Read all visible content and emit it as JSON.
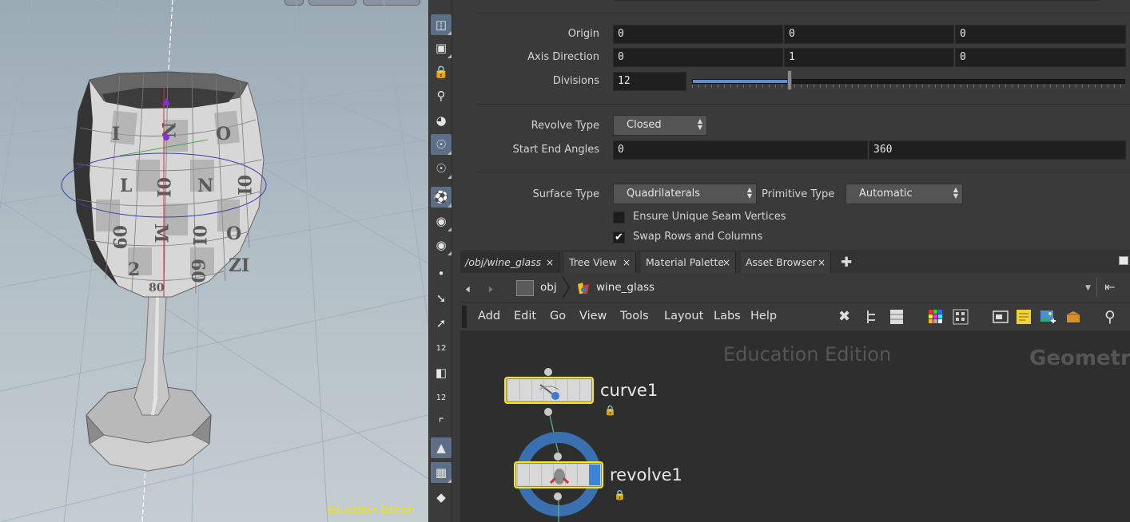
{
  "viewport": {
    "watermark": "Education Edition",
    "uv_labels": [
      "N",
      "O",
      "I",
      "L",
      "0I",
      "N",
      "0I",
      "M",
      "O",
      "0I",
      "09",
      "60",
      "2",
      "ZI",
      "80"
    ]
  },
  "shelf": {
    "tools": [
      {
        "icon": "view-layers-icon",
        "active": true
      },
      {
        "icon": "display-options-icon",
        "active": false
      },
      {
        "icon": "lock-camera-icon",
        "active": false
      },
      {
        "icon": "ghost-icon",
        "active": false
      },
      {
        "icon": "snapshot-icon",
        "active": false
      },
      {
        "icon": "light-bulb-icon",
        "active": true
      },
      {
        "icon": "light-link-icon",
        "active": false
      },
      {
        "icon": "shading-icon",
        "active": true
      },
      {
        "icon": "eye-visibility-icon",
        "active": false
      },
      {
        "icon": "template-icon",
        "active": false
      },
      {
        "icon": "point-display-icon",
        "active": false
      },
      {
        "icon": "normal-display-icon",
        "active": false
      },
      {
        "icon": "vector-display-icon",
        "active": false
      },
      {
        "icon": "point-number-icon",
        "text": "12",
        "active": false
      },
      {
        "icon": "primitive-normal-icon",
        "active": false
      },
      {
        "icon": "primitive-number-icon",
        "text": "12",
        "active": false
      },
      {
        "icon": "vertex-icon",
        "active": false
      },
      {
        "icon": "shaded-surface-icon",
        "active": true
      },
      {
        "icon": "texture-checker-icon",
        "active": true
      },
      {
        "icon": "uv-icon",
        "active": false
      }
    ]
  },
  "params": {
    "origin": {
      "label": "Origin",
      "x": "0",
      "y": "0",
      "z": "0"
    },
    "axis_direction": {
      "label": "Axis Direction",
      "x": "0",
      "y": "1",
      "z": "0"
    },
    "divisions": {
      "label": "Divisions",
      "value": "12",
      "slider_fraction": 0.225
    },
    "revolve_type": {
      "label": "Revolve Type",
      "value": "Closed"
    },
    "start_end_angles": {
      "label": "Start End Angles",
      "start": "0",
      "end": "360"
    },
    "surface_type": {
      "label": "Surface Type",
      "value": "Quadrilaterals"
    },
    "primitive_type": {
      "label": "Primitive Type",
      "value": "Automatic"
    },
    "ensure_unique": {
      "label": "Ensure Unique Seam Vertices",
      "checked": false
    },
    "swap_rows": {
      "label": "Swap Rows and Columns",
      "checked": true
    }
  },
  "network": {
    "tabs": [
      {
        "label": "/obj/wine_glass",
        "active": true
      },
      {
        "label": "Tree View",
        "active": false
      },
      {
        "label": "Material Palette",
        "active": false
      },
      {
        "label": "Asset Browser",
        "active": false
      }
    ],
    "path": [
      "obj",
      "wine_glass"
    ],
    "menu": [
      "Add",
      "Edit",
      "Go",
      "View",
      "Tools",
      "Layout",
      "Labs",
      "Help"
    ],
    "watermark": "Education Edition",
    "context_label": "Geometry",
    "nodes": [
      {
        "name": "curve1"
      },
      {
        "name": "revolve1",
        "display": true
      }
    ]
  }
}
